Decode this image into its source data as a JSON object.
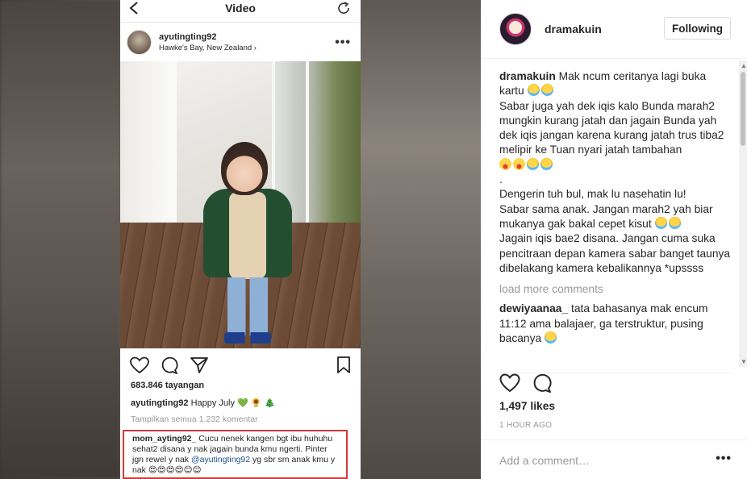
{
  "phone": {
    "title": "Video",
    "username": "ayutingting92",
    "location": "Hawke's Bay, New Zealand ›",
    "views": "683.846 tayangan",
    "caption_user": "ayutingting92",
    "caption_text": "Happy July 💚 🌻 🎄",
    "view_all": "Tampilkan semua 1.232 komentar",
    "comment_user": "mom_ayting92_",
    "comment_text_1": "Cucu nenek kangen bgt ibu huhuhu sehat2 disana y nak jagain bunda kmu ngerti. Pinter jgn rewel y nak",
    "comment_mention": "@ayutingting92",
    "comment_text_2": "yg sbr sm anak kmu y nak 😍😍😍😍😊😊"
  },
  "side": {
    "username": "dramakuin",
    "follow_label": "Following",
    "caption_user": "dramakuin",
    "caption_lines": [
      "Mak ncum ceritanya lagi buka kartu",
      "Sabar juga yah dek iqis kalo Bunda marah2 mungkin kurang jatah dan jagain Bunda yah dek iqis jangan karena kurang jatah trus tiba2 melipir ke Tuan nyari jatah tambahan",
      ".",
      "Dengerin tuh bul, mak lu nasehatin lu!",
      "Sabar sama anak. Jangan marah2 yah biar mukanya gak bakal cepet kisut",
      "Jagain iqis bae2 disana. Jangan cuma suka pencitraan depan kamera sabar banget taunya dibelakang kamera kebalikannya *upssss"
    ],
    "load_more": "load more comments",
    "comment_user": "dewiyaanaa_",
    "comment_text": "tata bahasanya mak encum 11:12 ama balajaer, ga terstruktur, pusing bacanya",
    "likes": "1,497 likes",
    "time": "1 HOUR AGO",
    "add_comment_placeholder": "Add a comment…"
  },
  "icons": {
    "back": "chevron-left-icon",
    "refresh": "refresh-icon",
    "more": "more-horizontal-icon",
    "heart": "heart-icon",
    "comment": "comment-icon",
    "share": "send-icon",
    "bookmark": "bookmark-icon"
  },
  "colors": {
    "highlight_border": "#d03a3a",
    "mention": "#1f4f8f",
    "muted": "#999999",
    "text": "#262626"
  }
}
